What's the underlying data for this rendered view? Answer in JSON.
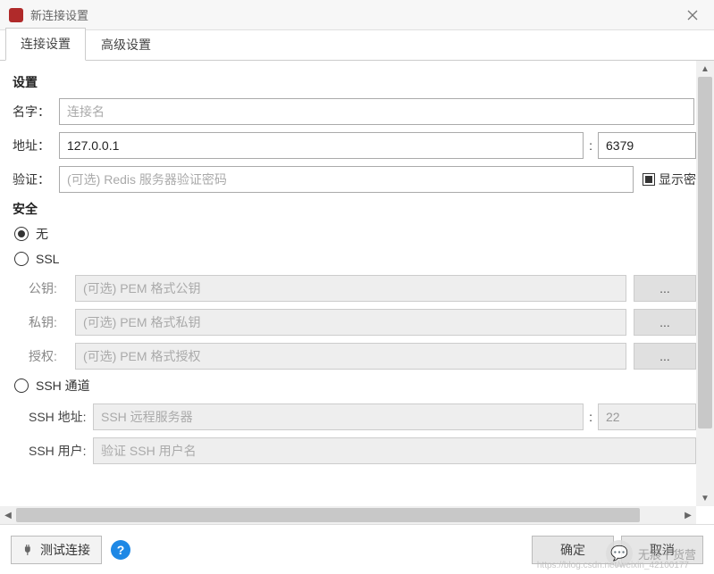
{
  "window": {
    "title": "新连接设置"
  },
  "tabs": {
    "connection": "连接设置",
    "advanced": "高级设置",
    "active": 0
  },
  "settings": {
    "heading": "设置",
    "name": {
      "label": "名字：",
      "placeholder": "连接名",
      "value": ""
    },
    "address": {
      "label": "地址：",
      "host": "127.0.0.1",
      "port": "6379",
      "colon": ":"
    },
    "auth": {
      "label": "验证：",
      "placeholder": "(可选) Redis 服务器验证密码",
      "value": "",
      "showpw_label": "显示密"
    }
  },
  "security": {
    "heading": "安全",
    "selected": "none",
    "options": {
      "none": "无",
      "ssl": "SSL",
      "ssh": "SSH 通道"
    },
    "ssl": {
      "pubkey": {
        "label": "公钥:",
        "placeholder": "(可选) PEM 格式公钥"
      },
      "privkey": {
        "label": "私钥:",
        "placeholder": "(可选) PEM 格式私钥"
      },
      "authkey": {
        "label": "授权:",
        "placeholder": "(可选) PEM 格式授权"
      },
      "browse": "..."
    },
    "ssh": {
      "host_label": "SSH 地址:",
      "host_placeholder": "SSH 远程服务器",
      "port": "22",
      "user_label": "SSH 用户:",
      "user_placeholder": "验证 SSH 用户名",
      "colon": ":"
    }
  },
  "footer": {
    "test": "测试连接",
    "help": "?",
    "ok": "确定",
    "cancel": "取消"
  },
  "watermark": {
    "text": "无痕干货营",
    "sub": "https://blog.csdn.net/weixin_42100177"
  }
}
